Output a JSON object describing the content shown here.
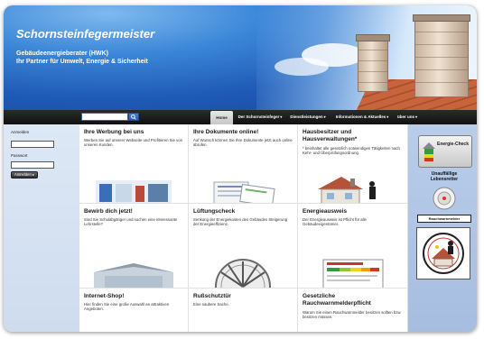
{
  "header": {
    "title": "Schornsteinfegermeister",
    "subtitle_line1": "Gebäudeenergieberater (HWK)",
    "subtitle_line2": "Ihr Partner für Umwelt, Energie & Sicherheit"
  },
  "nav": {
    "search_value": "",
    "items": [
      {
        "label": "Home",
        "active": true,
        "has_dropdown": false
      },
      {
        "label": "Der Schornsteinfeger",
        "active": false,
        "has_dropdown": true
      },
      {
        "label": "Dienstleistungen",
        "active": false,
        "has_dropdown": true
      },
      {
        "label": "Informationen & Aktuelles",
        "active": false,
        "has_dropdown": true
      },
      {
        "label": "über uns",
        "active": false,
        "has_dropdown": true
      }
    ],
    "dropdown_glyph": "▾"
  },
  "login": {
    "username_label": "Anmelden",
    "password_label": "Passwort",
    "button_label": "Anmelden ▸"
  },
  "tiles": [
    {
      "title": "Ihre Werbung bei uns",
      "text": "Werben Sie auf unserer Webseite und Profitieren Sie von unseren Kunden.",
      "image": "advertising-image"
    },
    {
      "title": "Ihre Dokumente online!",
      "text": "Auf Wunsch können Sie Ihre Dokumente jetzt auch online abrufen.",
      "image": "documents-image"
    },
    {
      "title": "Hausbesitzer und Hausverwaltungen*",
      "text": "* beinhaltet alle gesetzlich notwendigen Tätigkeiten nach Kehr- und Überprüfungsordnung.",
      "image": "house-chimney-sweep-image"
    },
    {
      "title": "Bewirb dich jetzt!",
      "text": "Sind Sie Schulabgänger und suchen eine interessante Lehrstelle?",
      "image": "apprenticeship-image"
    },
    {
      "title": "Lüftungscheck",
      "text": "Senkung der Energiekosten des Gebäudes Steigerung der Energieeffizienz.",
      "image": "ventilation-fan-image"
    },
    {
      "title": "Energieausweis",
      "text": "Der Energieausweis ist Pflicht für alle Gebäudeeigentümer.",
      "image": "energy-certificate-image"
    },
    {
      "title": "Internet-Shop!",
      "text": "Hier finden Sie eine große Auswahl an attraktiven Angeboten.",
      "image": "shop-image"
    },
    {
      "title": "Rußschutztür",
      "text": "Eine saubere Sache.",
      "image": "soot-door-image"
    },
    {
      "title": "Gesetzliche Rauchwarnmelderpflicht",
      "text": "Warum Sie einen Rauchwarnmelder besitzen sollten bzw. besitzen müssen.",
      "image": "smoke-detector-image"
    }
  ],
  "sidebar_right": {
    "energie_check_label": "Energie-Check",
    "lebensretter_line1": "Unauffällige",
    "lebensretter_line2": "Lebensretter",
    "rauchwarnmelder_label": "Rauchwarnmelder"
  },
  "colors": {
    "banner_blue": "#1f5ab6",
    "nav_dark": "#111111",
    "login_bg": "#d6e2f2",
    "right_col_bg": "#b0c4e5"
  }
}
